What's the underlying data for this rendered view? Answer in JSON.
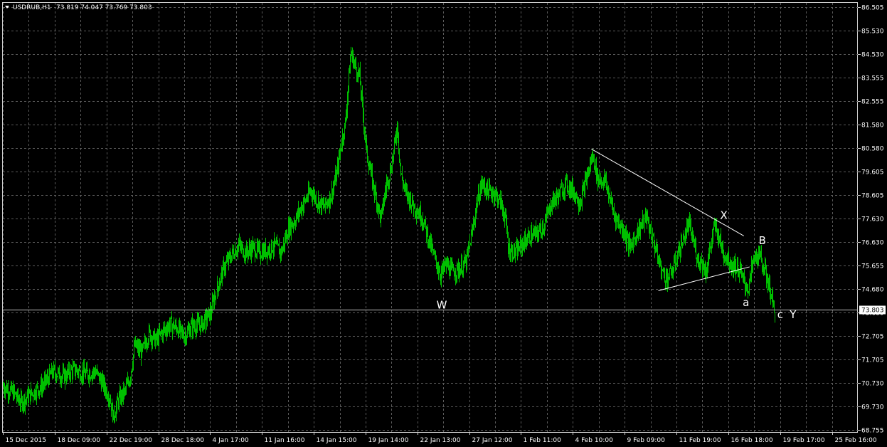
{
  "window": {
    "symbol_title": "USDRUB,H1",
    "ohlc": "73.819 74.047 73.769 73.803",
    "current_price": "73.803"
  },
  "colors": {
    "background": "#000000",
    "grid": "#5a5a5a",
    "candles": "#00c000",
    "text": "#ffffff",
    "price_tag_bg": "#ffffff",
    "price_tag_text": "#000000",
    "trendlines": "#ffffff"
  },
  "chart_data": {
    "type": "line",
    "grid": true,
    "ylim": [
      68.755,
      86.505
    ],
    "y_ticks": [
      "86.505",
      "85.530",
      "84.530",
      "83.555",
      "82.555",
      "81.580",
      "80.580",
      "79.605",
      "78.605",
      "77.630",
      "76.630",
      "75.655",
      "74.680",
      "73.680",
      "72.705",
      "71.705",
      "70.730",
      "69.730",
      "68.755"
    ],
    "x_ticks": [
      "15 Dec 2015",
      "18 Dec 09:00",
      "22 Dec 19:00",
      "28 Dec 18:00",
      "4 Jan 17:00",
      "11 Jan 16:00",
      "14 Jan 15:00",
      "19 Jan 14:00",
      "22 Jan 13:00",
      "27 Jan 12:00",
      "1 Feb 11:00",
      "4 Feb 10:00",
      "9 Feb 09:00",
      "11 Feb 19:00",
      "16 Feb 18:00",
      "19 Feb 17:00",
      "25 Feb 16:00"
    ],
    "x_index_range": [
      0,
      1200
    ],
    "price_path": [
      [
        0,
        70.6
      ],
      [
        15,
        70.3
      ],
      [
        25,
        69.9
      ],
      [
        40,
        70.3
      ],
      [
        55,
        70.6
      ],
      [
        70,
        71.2
      ],
      [
        85,
        71.0
      ],
      [
        100,
        71.3
      ],
      [
        115,
        71.1
      ],
      [
        130,
        71.2
      ],
      [
        140,
        70.7
      ],
      [
        150,
        70.1
      ],
      [
        155,
        69.3
      ],
      [
        162,
        70.0
      ],
      [
        170,
        70.3
      ],
      [
        178,
        70.9
      ],
      [
        185,
        72.3
      ],
      [
        195,
        72.0
      ],
      [
        205,
        72.8
      ],
      [
        215,
        72.5
      ],
      [
        225,
        72.9
      ],
      [
        235,
        73.2
      ],
      [
        245,
        73.0
      ],
      [
        255,
        72.7
      ],
      [
        265,
        73.1
      ],
      [
        280,
        73.2
      ],
      [
        292,
        73.7
      ],
      [
        300,
        74.7
      ],
      [
        310,
        75.6
      ],
      [
        320,
        76.1
      ],
      [
        330,
        76.5
      ],
      [
        340,
        76.2
      ],
      [
        350,
        76.4
      ],
      [
        360,
        76.2
      ],
      [
        370,
        76.3
      ],
      [
        380,
        76.5
      ],
      [
        390,
        76.2
      ],
      [
        400,
        77.2
      ],
      [
        410,
        77.6
      ],
      [
        420,
        78.2
      ],
      [
        432,
        78.8
      ],
      [
        440,
        78.4
      ],
      [
        450,
        78.1
      ],
      [
        460,
        78.6
      ],
      [
        468,
        79.5
      ],
      [
        475,
        80.9
      ],
      [
        480,
        81.6
      ],
      [
        485,
        83.6
      ],
      [
        488,
        84.6
      ],
      [
        492,
        84.2
      ],
      [
        500,
        83.6
      ],
      [
        505,
        82.0
      ],
      [
        510,
        80.4
      ],
      [
        518,
        79.2
      ],
      [
        525,
        78.3
      ],
      [
        530,
        77.6
      ],
      [
        538,
        79.1
      ],
      [
        543,
        79.6
      ],
      [
        548,
        80.4
      ],
      [
        553,
        81.6
      ],
      [
        558,
        79.5
      ],
      [
        565,
        78.7
      ],
      [
        572,
        78.4
      ],
      [
        580,
        78.0
      ],
      [
        588,
        77.7
      ],
      [
        596,
        76.9
      ],
      [
        605,
        76.0
      ],
      [
        614,
        75.3
      ],
      [
        622,
        75.7
      ],
      [
        630,
        75.4
      ],
      [
        640,
        75.5
      ],
      [
        650,
        75.8
      ],
      [
        658,
        77.0
      ],
      [
        665,
        78.3
      ],
      [
        672,
        79.1
      ],
      [
        680,
        78.8
      ],
      [
        690,
        78.7
      ],
      [
        700,
        78.2
      ],
      [
        705,
        77.6
      ],
      [
        710,
        76.3
      ],
      [
        720,
        76.2
      ],
      [
        730,
        76.6
      ],
      [
        740,
        76.9
      ],
      [
        750,
        77.0
      ],
      [
        760,
        77.4
      ],
      [
        770,
        78.3
      ],
      [
        780,
        78.6
      ],
      [
        790,
        79.1
      ],
      [
        800,
        78.8
      ],
      [
        810,
        78.3
      ],
      [
        820,
        79.4
      ],
      [
        828,
        80.3
      ],
      [
        835,
        79.3
      ],
      [
        845,
        79.2
      ],
      [
        850,
        78.7
      ],
      [
        858,
        77.8
      ],
      [
        865,
        77.4
      ],
      [
        872,
        77.1
      ],
      [
        880,
        76.4
      ],
      [
        888,
        76.9
      ],
      [
        895,
        77.3
      ],
      [
        902,
        77.7
      ],
      [
        910,
        76.9
      ],
      [
        915,
        76.4
      ],
      [
        920,
        75.8
      ],
      [
        926,
        75.3
      ],
      [
        932,
        75.1
      ],
      [
        940,
        75.5
      ],
      [
        948,
        76.3
      ],
      [
        955,
        76.8
      ],
      [
        962,
        77.4
      ],
      [
        968,
        76.7
      ],
      [
        975,
        75.9
      ],
      [
        980,
        75.8
      ],
      [
        986,
        75.4
      ],
      [
        992,
        76.4
      ],
      [
        998,
        77.3
      ],
      [
        1004,
        76.9
      ],
      [
        1010,
        76.2
      ],
      [
        1016,
        76.0
      ],
      [
        1022,
        75.7
      ],
      [
        1028,
        75.6
      ],
      [
        1034,
        75.4
      ],
      [
        1040,
        74.9
      ],
      [
        1046,
        74.7
      ],
      [
        1052,
        75.8
      ],
      [
        1058,
        76.1
      ],
      [
        1064,
        75.9
      ],
      [
        1070,
        75.3
      ],
      [
        1076,
        74.7
      ],
      [
        1080,
        74.0
      ],
      [
        1083,
        73.8
      ]
    ],
    "trendlines": [
      {
        "from": [
          826,
          80.55
        ],
        "to": [
          1040,
          76.9
        ]
      },
      {
        "from": [
          920,
          74.6
        ],
        "to": [
          1048,
          75.6
        ]
      }
    ],
    "annotations": [
      {
        "text": "W",
        "x": 616,
        "y": 73.85
      },
      {
        "text": "X",
        "x": 1012,
        "y": 77.62
      },
      {
        "text": "B",
        "x": 1066,
        "y": 76.55
      },
      {
        "text": "a",
        "x": 1043,
        "y": 73.95
      },
      {
        "text": "c",
        "x": 1091,
        "y": 73.45
      },
      {
        "text": "Y",
        "x": 1109,
        "y": 73.45
      }
    ]
  }
}
